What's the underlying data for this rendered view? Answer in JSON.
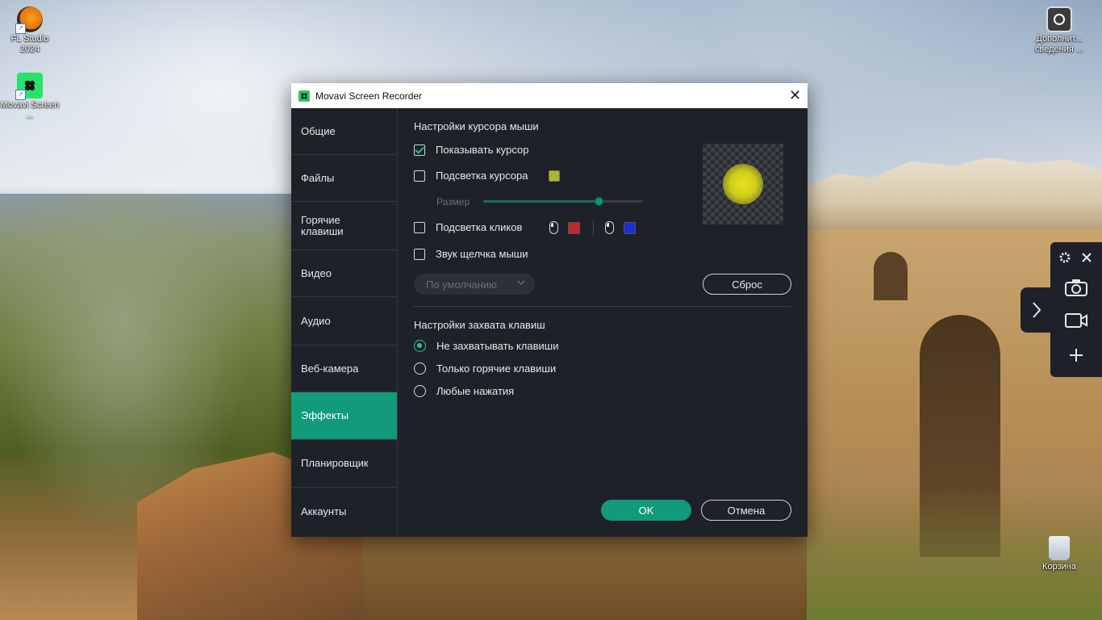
{
  "desktop": {
    "icons": [
      {
        "label": "FL Studio 2024"
      },
      {
        "label": "Movavi Screen ..."
      },
      {
        "label": "Дополнит... сведения ..."
      },
      {
        "label": "Корзина"
      }
    ]
  },
  "window": {
    "title": "Movavi Screen Recorder",
    "close_glyph": "✕"
  },
  "sidebar": {
    "items": [
      {
        "label": "Общие"
      },
      {
        "label": "Файлы"
      },
      {
        "label": "Горячие клавиши"
      },
      {
        "label": "Видео"
      },
      {
        "label": "Аудио"
      },
      {
        "label": "Веб-камера"
      },
      {
        "label": "Эффекты",
        "active": true
      },
      {
        "label": "Планировщик"
      },
      {
        "label": "Аккаунты"
      }
    ]
  },
  "cursor_settings": {
    "title": "Настройки курсора мыши",
    "show_cursor": {
      "label": "Показывать курсор",
      "checked": true
    },
    "cursor_highlight": {
      "label": "Подсветка курсора",
      "checked": false
    },
    "size_label": "Размер",
    "size_value": 0.72,
    "click_highlight": {
      "label": "Подсветка кликов",
      "checked": false,
      "left_color": "#c0282d",
      "right_color": "#1f2fd6"
    },
    "click_sound": {
      "label": "Звук щелчка мыши",
      "checked": false
    },
    "sound_dropdown": {
      "value": "По умолчанию"
    },
    "reset_label": "Сброс",
    "preview_color": "#e6e21a"
  },
  "key_capture": {
    "title": "Настройки захвата клавиш",
    "options": [
      {
        "label": "Не захватывать клавиши",
        "selected": true
      },
      {
        "label": "Только горячие клавиши",
        "selected": false
      },
      {
        "label": "Любые нажатия",
        "selected": false
      }
    ]
  },
  "footer": {
    "ok_label": "OK",
    "cancel_label": "Отмена"
  },
  "colors": {
    "accent": "#129a7a",
    "dialog_bg": "#1f2129"
  }
}
